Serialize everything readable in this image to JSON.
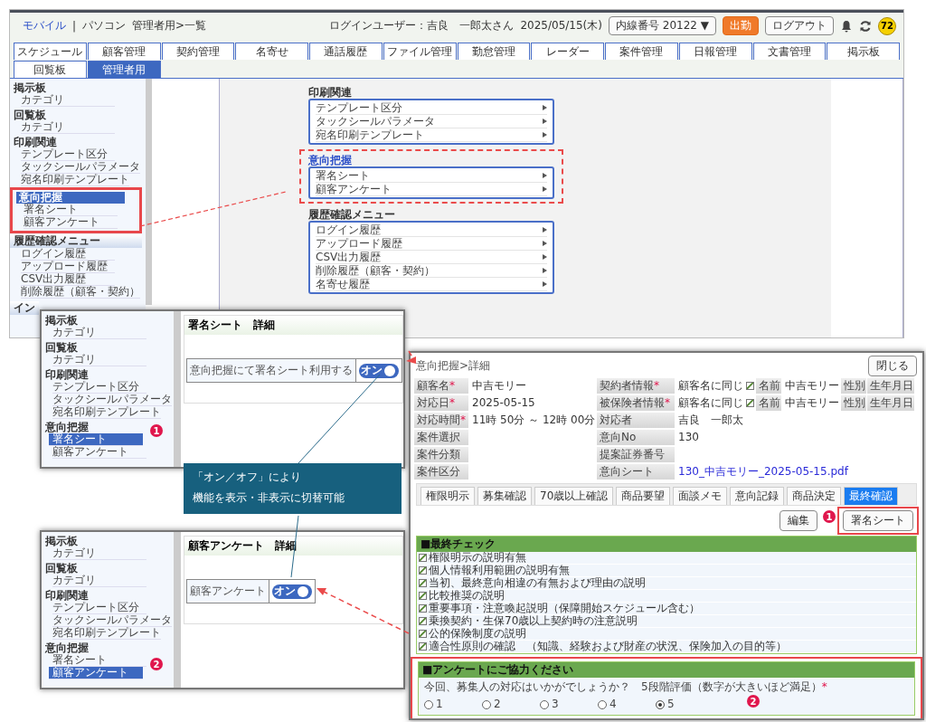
{
  "main_window": {
    "breadcrumb": {
      "mobile_link": "モバイル",
      "separator": "|",
      "pc": "パソコン",
      "path": "管理者用>一覧"
    },
    "login_user": "ログインユーザー：吉良　一郎太さん",
    "date": "2025/05/15(木)",
    "extension": "内線番号 20122 ▼",
    "clock_in": "出勤",
    "logout": "ログアウト",
    "notification_count": "72",
    "tabs": [
      {
        "label": "スケジュール",
        "selected": false
      },
      {
        "label": "顧客管理",
        "selected": false
      },
      {
        "label": "契約管理",
        "selected": false
      },
      {
        "label": "名寄せ",
        "selected": false
      },
      {
        "label": "通話履歴",
        "selected": false
      },
      {
        "label": "ファイル管理",
        "selected": false
      },
      {
        "label": "勤怠管理",
        "selected": false
      },
      {
        "label": "レーダー",
        "selected": false
      },
      {
        "label": "案件管理",
        "selected": false
      },
      {
        "label": "日報管理",
        "selected": false
      },
      {
        "label": "文書管理",
        "selected": false
      },
      {
        "label": "掲示板",
        "selected": false
      },
      {
        "label": "回覧板",
        "selected": false
      },
      {
        "label": "管理者用",
        "selected": true
      }
    ],
    "sidebar": [
      {
        "title": "掲示板",
        "kind": "heading",
        "selected": false,
        "highlighted": false,
        "items": [
          {
            "label": "カテゴリ",
            "selected": false
          }
        ]
      },
      {
        "title": "回覧板",
        "kind": "heading",
        "selected": false,
        "highlighted": false,
        "items": [
          {
            "label": "カテゴリ",
            "selected": false
          }
        ]
      },
      {
        "title": "印刷関連",
        "kind": "heading",
        "selected": false,
        "highlighted": false,
        "items": [
          {
            "label": "テンプレート区分",
            "selected": false
          },
          {
            "label": "タックシールパラメータ",
            "selected": false
          },
          {
            "label": "宛名印刷テンプレート",
            "selected": false
          }
        ]
      },
      {
        "title": "意向把握",
        "kind": "heading",
        "selected": true,
        "highlighted": true,
        "items": [
          {
            "label": "署名シート",
            "selected": false
          },
          {
            "label": "顧客アンケート",
            "selected": false
          }
        ]
      },
      {
        "title": "履歴確認メニュー",
        "kind": "bar",
        "selected": false,
        "highlighted": false,
        "items": [
          {
            "label": "ログイン履歴",
            "selected": false
          },
          {
            "label": "アップロード履歴",
            "selected": false
          },
          {
            "label": "CSV出力履歴",
            "selected": false
          },
          {
            "label": "削除履歴（顧客・契約）",
            "selected": false
          }
        ]
      },
      {
        "title": "イン",
        "kind": "bar",
        "selected": false,
        "highlighted": false
      }
    ],
    "menu_groups": [
      {
        "title": "印刷関連",
        "highlighted": false,
        "items": [
          "テンプレート区分",
          "タックシールパラメータ",
          "宛名印刷テンプレート"
        ]
      },
      {
        "title": "意向把握",
        "highlighted": true,
        "items": [
          "署名シート",
          "顧客アンケート"
        ]
      },
      {
        "title": "履歴確認メニュー",
        "highlighted": false,
        "items": [
          "ログイン履歴",
          "アップロード履歴",
          "CSV出力履歴",
          "削除履歴（顧客・契約）",
          "名寄せ履歴"
        ]
      }
    ]
  },
  "signature_window": {
    "sidebar": [
      {
        "title": "掲示板",
        "items": [
          {
            "label": "カテゴリ",
            "selected": false
          }
        ]
      },
      {
        "title": "回覧板",
        "items": [
          {
            "label": "カテゴリ",
            "selected": false
          }
        ]
      },
      {
        "title": "印刷関連",
        "items": [
          {
            "label": "テンプレート区分",
            "selected": false
          },
          {
            "label": "タックシールパラメータ",
            "selected": false
          },
          {
            "label": "宛名印刷テンプレート",
            "selected": false
          }
        ]
      },
      {
        "title": "意向把握",
        "items": [
          {
            "label": "署名シート",
            "selected": true,
            "badge": "1"
          },
          {
            "label": "顧客アンケート",
            "selected": false
          }
        ]
      }
    ],
    "title": "署名シート　詳細",
    "setting": {
      "label": "意向把握にて署名シート利用する",
      "toggle": {
        "label": "オン",
        "on": true
      }
    }
  },
  "callout": {
    "lines": [
      "「オン／オフ」により",
      "機能を表示・非表示に切替可能"
    ]
  },
  "survey_window": {
    "sidebar": [
      {
        "title": "掲示板",
        "items": [
          {
            "label": "カテゴリ",
            "selected": false
          }
        ]
      },
      {
        "title": "回覧板",
        "items": [
          {
            "label": "カテゴリ",
            "selected": false
          }
        ]
      },
      {
        "title": "印刷関連",
        "items": [
          {
            "label": "テンプレート区分",
            "selected": false
          },
          {
            "label": "タックシールパラメータ",
            "selected": false
          },
          {
            "label": "宛名印刷テンプレート",
            "selected": false
          }
        ]
      },
      {
        "title": "意向把握",
        "items": [
          {
            "label": "署名シート",
            "selected": false
          },
          {
            "label": "顧客アンケート",
            "selected": true,
            "badge": "2"
          }
        ]
      }
    ],
    "title": "顧客アンケート　詳細",
    "setting": {
      "label": "顧客アンケート",
      "toggle": {
        "label": "オン",
        "on": true
      }
    }
  },
  "detail_window": {
    "title": "意向把握>詳細",
    "close": "閉じる",
    "rows": [
      [
        {
          "kind": "label",
          "text": "顧客名",
          "required_mark": "*"
        },
        {
          "kind": "value",
          "text": "中吉モリー"
        },
        {
          "kind": "label",
          "text": "契約者情報",
          "required_mark": "*"
        },
        {
          "kind": "check",
          "text": "顧客名に同じ",
          "checked": true
        },
        {
          "kind": "label",
          "text": "名前"
        },
        {
          "kind": "value",
          "text": "中吉モリー"
        },
        {
          "kind": "label",
          "text": "性別"
        },
        {
          "kind": "label",
          "text": "生年月日"
        }
      ],
      [
        {
          "kind": "label",
          "text": "対応日",
          "required_mark": "*"
        },
        {
          "kind": "value",
          "text": "2025-05-15"
        },
        {
          "kind": "label",
          "text": "被保険者情報",
          "required_mark": "*"
        },
        {
          "kind": "check",
          "text": "顧客名に同じ",
          "checked": true
        },
        {
          "kind": "label",
          "text": "名前"
        },
        {
          "kind": "value",
          "text": "中吉モリー"
        },
        {
          "kind": "label",
          "text": "性別"
        },
        {
          "kind": "label",
          "text": "生年月日"
        }
      ],
      [
        {
          "kind": "label",
          "text": "対応時間",
          "required_mark": "*"
        },
        {
          "kind": "value",
          "text": "11時 50分 ～ 12時 00分"
        },
        {
          "kind": "label",
          "text": "対応者"
        },
        {
          "kind": "value",
          "text": "吉良　一郎太"
        }
      ],
      [
        {
          "kind": "label",
          "text": "案件選択"
        },
        {
          "kind": "blank"
        },
        {
          "kind": "label",
          "text": "意向No"
        },
        {
          "kind": "value",
          "text": "130"
        }
      ],
      [
        {
          "kind": "label",
          "text": "案件分類"
        },
        {
          "kind": "blank"
        },
        {
          "kind": "label",
          "text": "提案証券番号"
        },
        {
          "kind": "blank"
        }
      ],
      [
        {
          "kind": "label",
          "text": "案件区分"
        },
        {
          "kind": "blank"
        },
        {
          "kind": "label",
          "text": "意向シート"
        },
        {
          "kind": "link",
          "text": "130_中吉モリー_2025-05-15.pdf"
        }
      ]
    ],
    "tabs": [
      {
        "label": "権限明示",
        "selected": false
      },
      {
        "label": "募集確認",
        "selected": false
      },
      {
        "label": "70歳以上確認",
        "selected": false
      },
      {
        "label": "商品要望",
        "selected": false
      },
      {
        "label": "面談メモ",
        "selected": false
      },
      {
        "label": "意向記録",
        "selected": false
      },
      {
        "label": "商品決定",
        "selected": false
      },
      {
        "label": "最終確認",
        "selected": true
      }
    ],
    "actions": [
      {
        "label": "編集",
        "highlighted": false
      },
      {
        "label": "署名シート",
        "highlighted": true,
        "badge": "1"
      }
    ],
    "final_check": {
      "title": "■最終チェック",
      "items": [
        {
          "label": "権限明示の説明有無",
          "checked": true
        },
        {
          "label": "個人情報利用範囲の説明有無",
          "checked": true
        },
        {
          "label": "当初、最終意向相違の有無および理由の説明",
          "checked": true
        },
        {
          "label": "比較推奨の説明",
          "checked": true
        },
        {
          "label": "重要事項・注意喚起説明（保障開始スケジュール含む）",
          "checked": true
        },
        {
          "label": "乗換契約・生保70歳以上契約時の注意説明",
          "checked": true
        },
        {
          "label": "公的保険制度の説明",
          "checked": true
        },
        {
          "label": "適合性原則の確認　（知識、経験および財産の状況、保険加入の目的等）",
          "checked": true
        }
      ]
    },
    "survey": {
      "title": "■アンケートにご協力ください",
      "highlighted": true,
      "badge": "2",
      "question": "今回、募集人の対応はいかがでしょうか？　5段階評価（数字が大きいほど満足）",
      "required_mark": "*",
      "options": [
        {
          "label": "1",
          "selected": false
        },
        {
          "label": "2",
          "selected": false
        },
        {
          "label": "3",
          "selected": false
        },
        {
          "label": "4",
          "selected": false
        },
        {
          "label": "5",
          "selected": true
        }
      ]
    }
  }
}
